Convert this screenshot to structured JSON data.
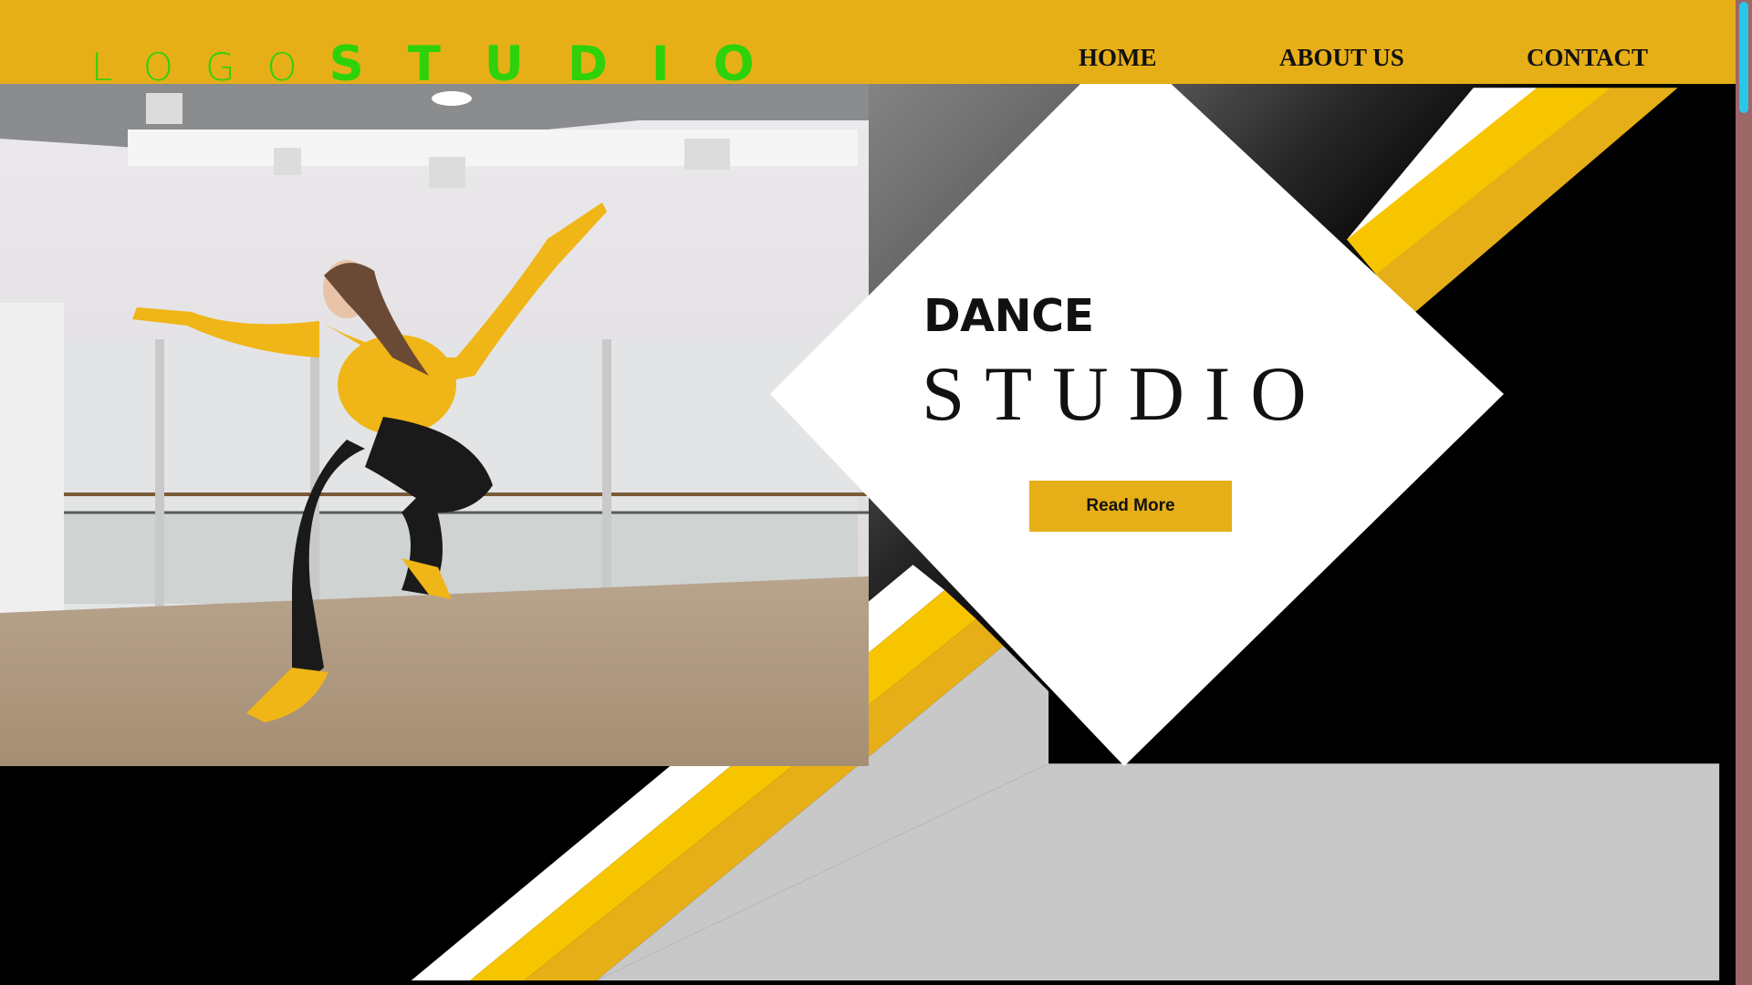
{
  "header": {
    "logo_light": "LOGO",
    "logo_bold": "STUDIO"
  },
  "nav": {
    "home": "HOME",
    "about": "ABOUT US",
    "contact": "CONTACT"
  },
  "hero": {
    "title": "DANCE",
    "subtitle": "STUDIO",
    "cta_label": "Read More"
  },
  "colors": {
    "header_bg": "#e6af18",
    "logo": "#2ed10a",
    "accent_yellow": "#f7c400",
    "accent_gold": "#e6af18",
    "scrollbar_track": "#9c6767",
    "scrollbar_thumb": "#29c7e8"
  },
  "hero_image": "dancer-leaping-in-studio"
}
